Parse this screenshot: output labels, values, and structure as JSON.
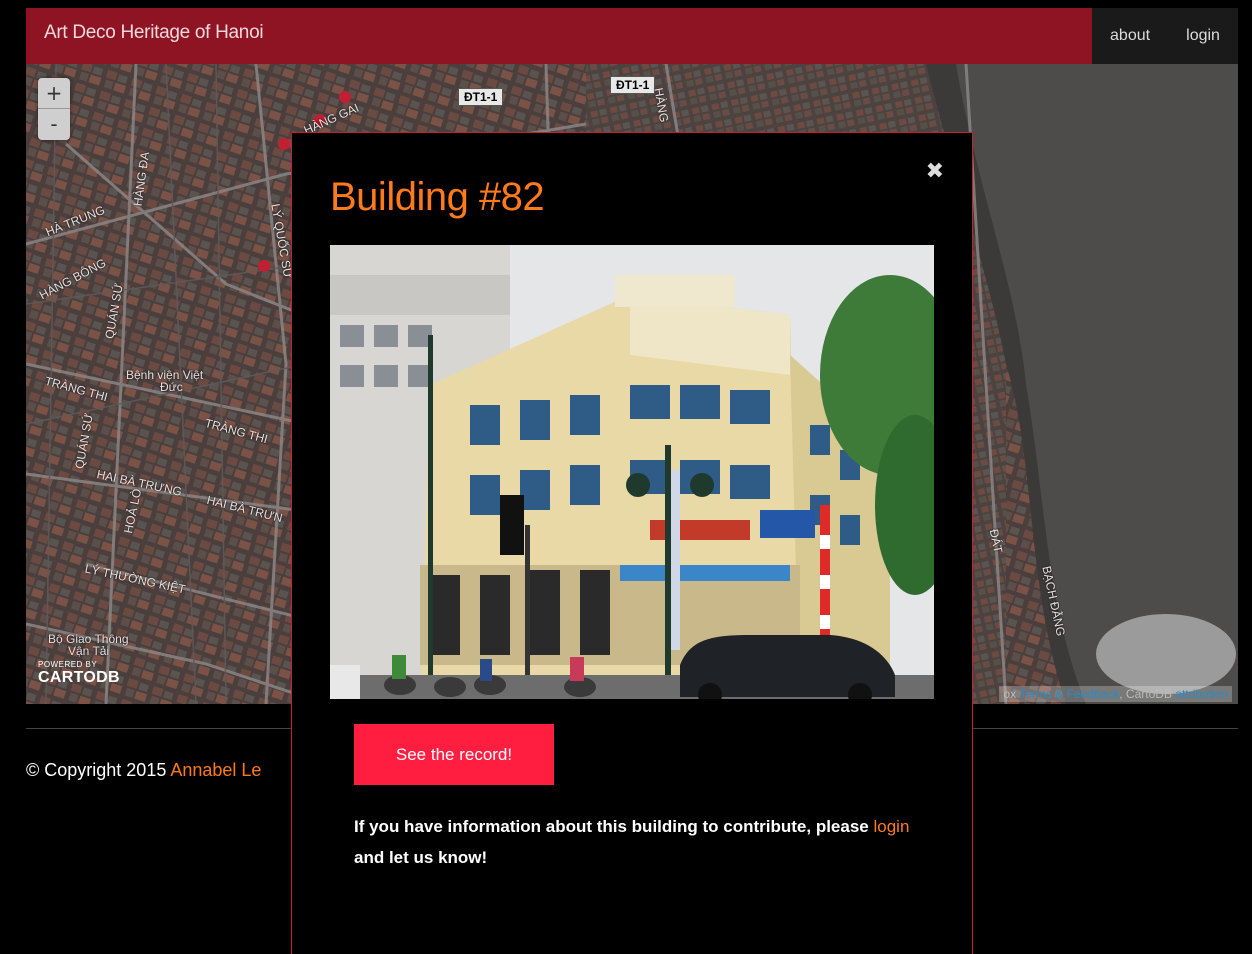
{
  "navbar": {
    "brand": "Art Deco Heritage of Hanoi",
    "links": [
      "about",
      "login"
    ]
  },
  "map": {
    "zoom_in": "+",
    "zoom_out": "-",
    "road_shields": [
      "ĐT1-1",
      "ĐT1-1"
    ],
    "street_labels": [
      "HÀ TRUNG",
      "HÀNG BÔNG",
      "QUÁN SỨ",
      "TRÀNG THI",
      "HÀNG ĐA",
      "LÝ QUỐC SƯ",
      "TRÀNG THI",
      "QUÁN SỨ",
      "HAI BÀ TRƯNG",
      "HAI BÀ TRƯN",
      "HOẢ LÒ",
      "LÝ THƯỜNG KIỆT",
      "HÀNG",
      "HÀNG GAI",
      "BẠCH ĐẰNG",
      "ĐÁT"
    ],
    "poi_labels": [
      "Bệnh viện Việt",
      "Đức",
      "Bộ Giao Thông",
      "Vận Tải"
    ],
    "cartodb_powered": "POWERED BY",
    "cartodb_logo": "CARTODB",
    "attribution_prefix": "ox",
    "attribution_terms": "Terms & Feedback",
    "attribution_mid": ", CartoDB",
    "attribution_link": "attribution"
  },
  "footer": {
    "copyright": "© Copyright 2015",
    "author": "Annabel Le"
  },
  "modal": {
    "title": "Building #82",
    "close_glyph": "✖",
    "cta_label": "See the record!",
    "info_before": "If you have information about this building to contribute, please",
    "info_link": "login",
    "info_after": "and let us know!"
  }
}
